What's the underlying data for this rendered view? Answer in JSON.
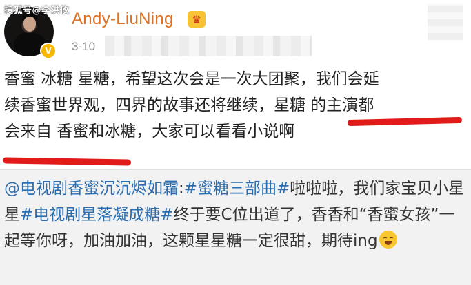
{
  "watermark": "搜狐号@李洪攸",
  "author": {
    "username": "Andy-LiuNing",
    "date": "3-10"
  },
  "post": {
    "lines": [
      "香蜜 冰糖 星糖，希望这次会是一次大团聚，我们会延",
      "续香蜜世界观，四界的故事还将继续，星糖 的主演都",
      "会来自 香蜜和冰糖，大家可以看看小说啊"
    ]
  },
  "repost": {
    "mention": "@电视剧香蜜沉沉烬如霜",
    "sep1": ":",
    "tag1": "#蜜糖三部曲#",
    "text1": "啦啦啦，我们家宝贝小星星",
    "tag2": "#电视剧星落凝成糖#",
    "text2": "终于要C位出道了，香香和“香蜜女孩”一起等你呀，加油加油，这颗星星糖一定很甜，期待ing"
  },
  "colors": {
    "username": "#e07020",
    "link": "#2a6db0",
    "underline": "#e11a1a",
    "repost_bg": "#f2f2f2"
  },
  "icons": [
    "verified-badge-icon",
    "vip-crown-icon",
    "smile-emoji-icon"
  ]
}
